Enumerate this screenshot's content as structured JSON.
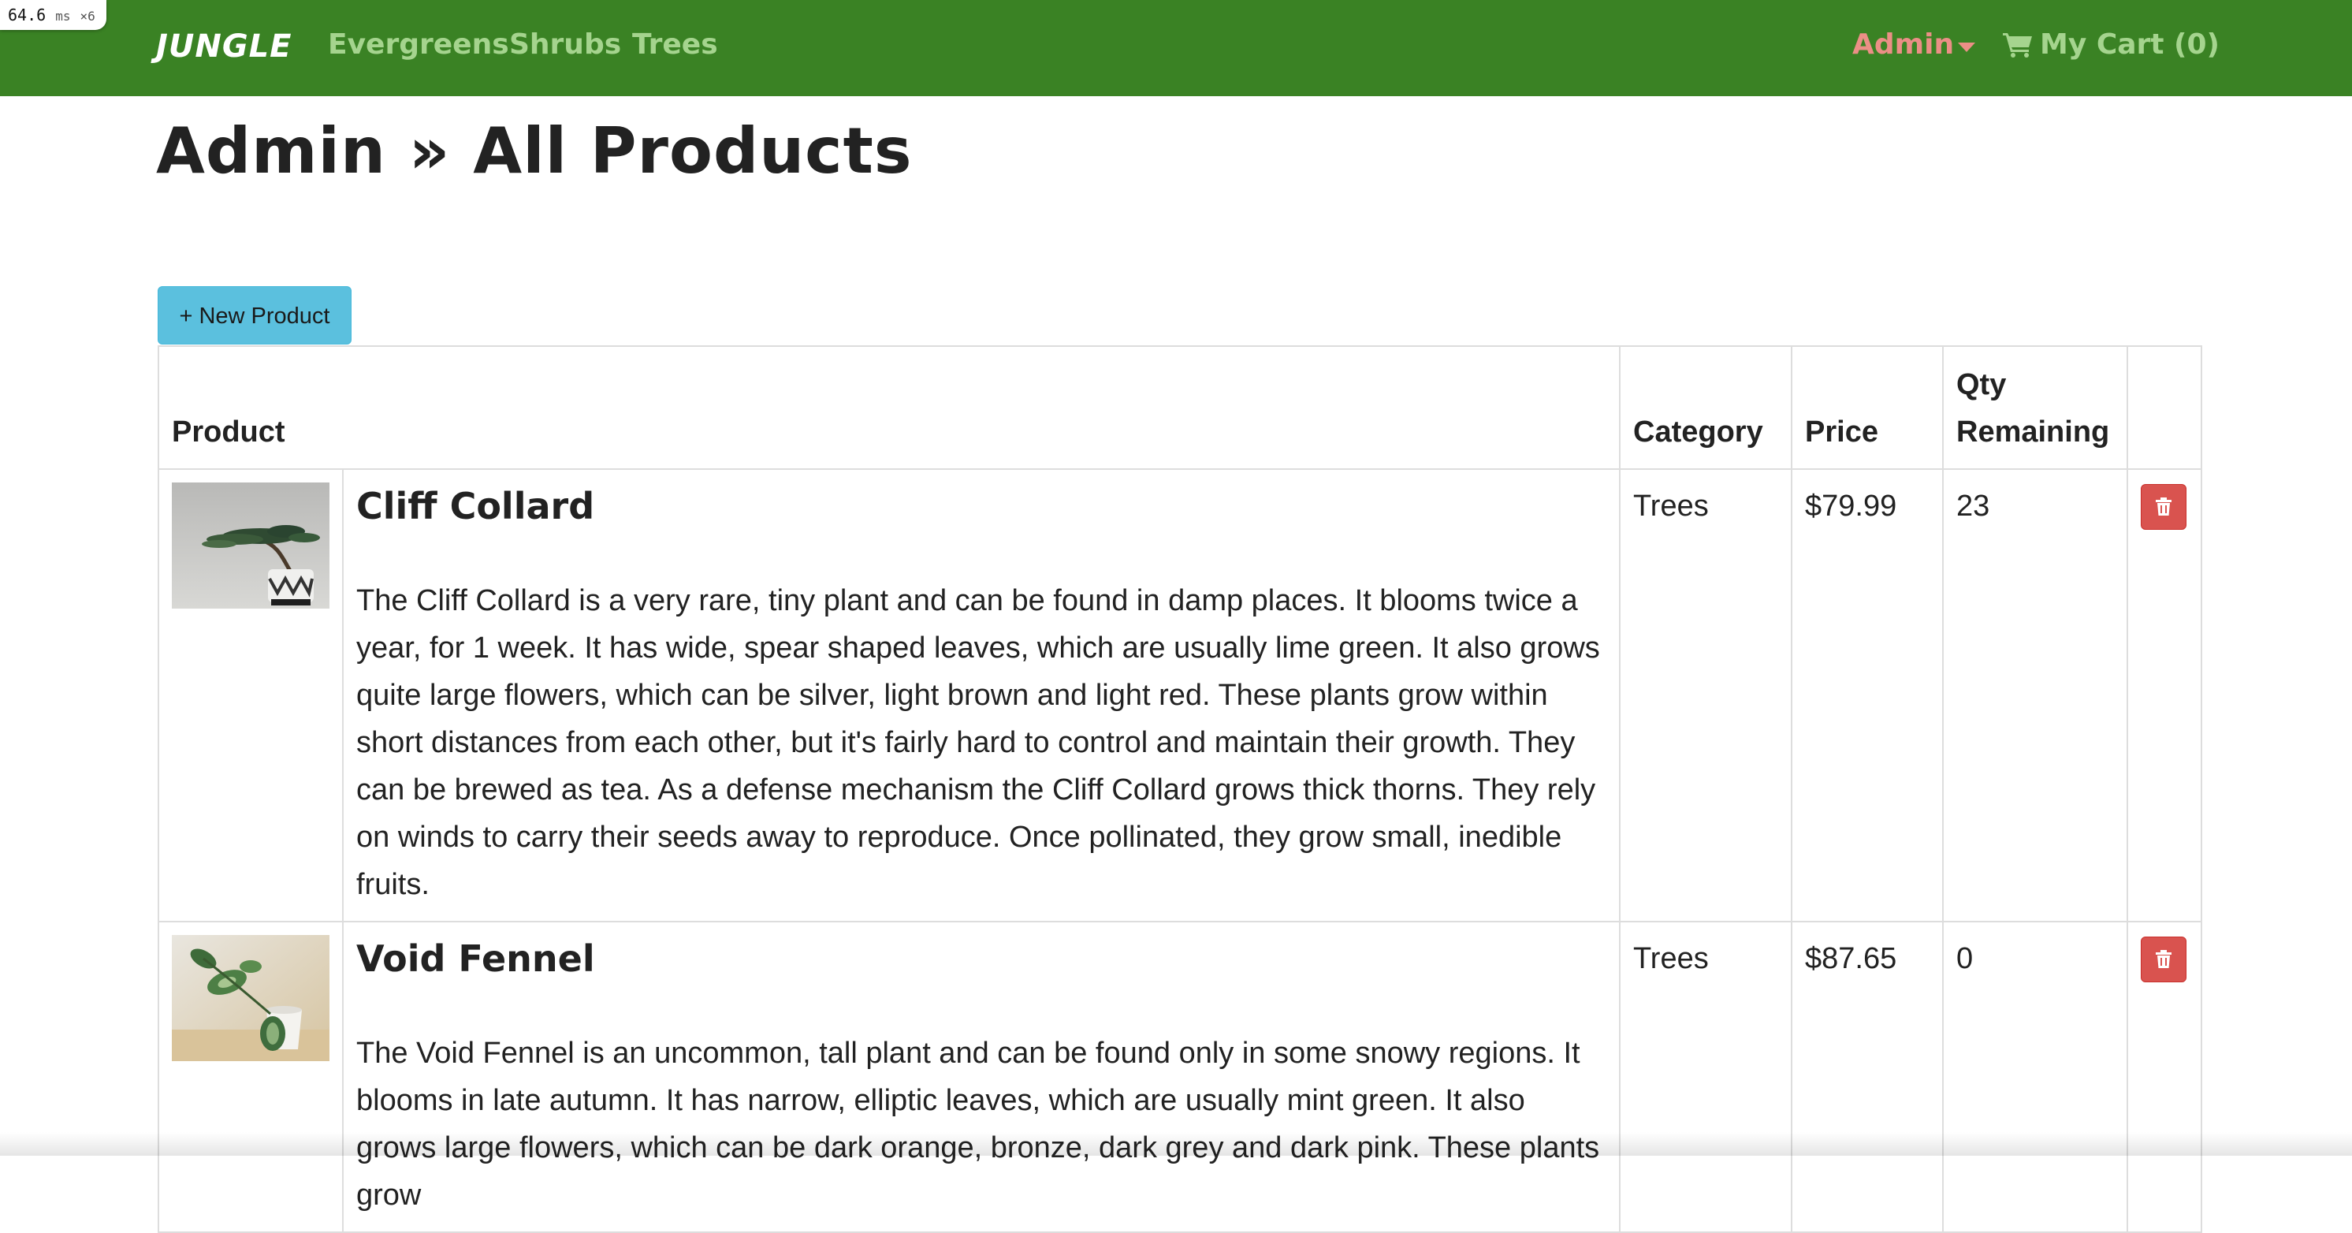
{
  "perf": {
    "value": "64.6",
    "unit": "ms",
    "multiplier": "×6"
  },
  "navbar": {
    "brand": "JUNGLE",
    "links": [
      "Evergreens",
      "Shrubs",
      "Trees"
    ],
    "admin_label": "Admin",
    "cart_label": "My Cart (0)",
    "bg_color": "#3a8224",
    "link_color": "#a5d48e",
    "admin_color": "#eb8f86"
  },
  "page": {
    "title": "Admin » All Products",
    "new_product_label": "+ New Product"
  },
  "table": {
    "headers": {
      "product": "Product",
      "category": "Category",
      "price": "Price",
      "qty": "Qty Remaining"
    },
    "rows": [
      {
        "image_icon": "bonsai-tree-thumbnail",
        "name": "Cliff Collard",
        "description": "The Cliff Collard is a very rare, tiny plant and can be found in damp places. It blooms twice a year, for 1 week. It has wide, spear shaped leaves, which are usually lime green. It also grows quite large flowers, which can be silver, light brown and light red. These plants grow within short distances from each other, but it's fairly hard to control and maintain their growth. They can be brewed as tea. As a defense mechanism the Cliff Collard grows thick thorns. They rely on winds to carry their seeds away to reproduce. Once pollinated, they grow small, inedible fruits.",
        "category": "Trees",
        "price": "$79.99",
        "qty": "23",
        "delete_icon": "trash-icon"
      },
      {
        "image_icon": "potted-leaf-thumbnail",
        "name": "Void Fennel",
        "description": "The Void Fennel is an uncommon, tall plant and can be found only in some snowy regions. It blooms in late autumn. It has narrow, elliptic leaves, which are usually mint green. It also grows large flowers, which can be dark orange, bronze, dark grey and dark pink. These plants grow",
        "category": "Trees",
        "price": "$87.65",
        "qty": "0",
        "delete_icon": "trash-icon"
      }
    ]
  },
  "colors": {
    "info_button": "#5bc0de",
    "danger_button": "#d9534f"
  }
}
